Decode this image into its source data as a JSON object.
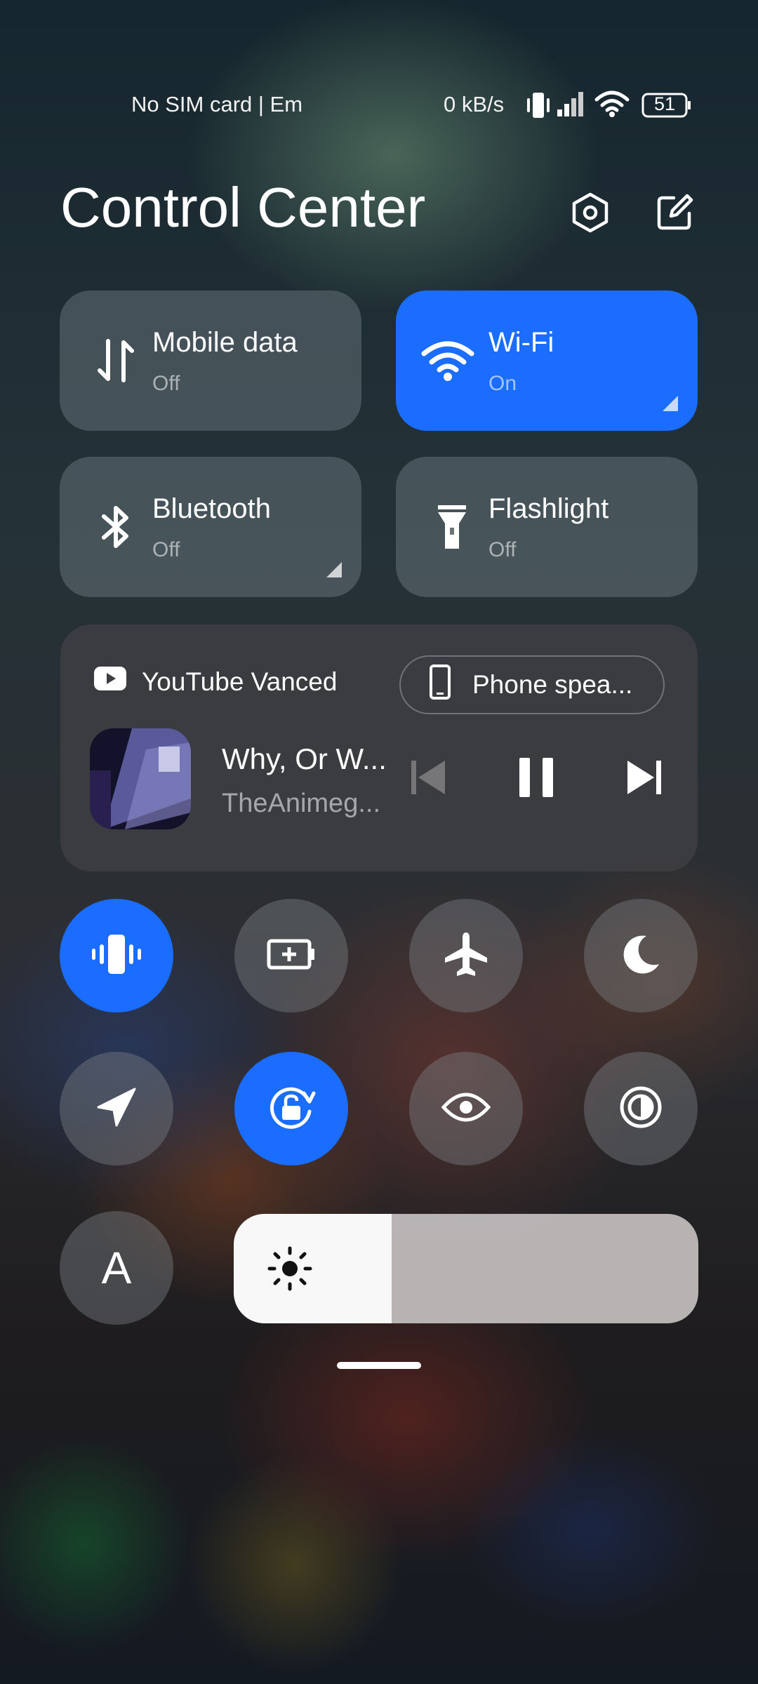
{
  "status_bar": {
    "carrier_text": "No SIM card | Em",
    "net_speed": "0 kB/s",
    "battery_level": "51",
    "icons": [
      "vibrate-icon",
      "signal-icon",
      "wifi-icon",
      "battery-icon"
    ]
  },
  "header": {
    "title": "Control Center",
    "settings_icon": "settings-hex-icon",
    "edit_icon": "edit-icon"
  },
  "tiles": [
    {
      "label": "Mobile data",
      "state": "Off",
      "icon": "mobile-data-icon",
      "active": false
    },
    {
      "label": "Wi-Fi",
      "state": "On",
      "icon": "wifi-icon",
      "active": true
    },
    {
      "label": "Bluetooth",
      "state": "Off",
      "icon": "bluetooth-icon",
      "active": false
    },
    {
      "label": "Flashlight",
      "state": "Off",
      "icon": "flashlight-icon",
      "active": false
    }
  ],
  "media": {
    "app_name": "YouTube Vanced",
    "output_device": "Phone spea...",
    "song_title": "Why, Or W...",
    "artist": "TheAnimeg...",
    "controls": [
      "previous-icon",
      "pause-icon",
      "next-icon"
    ]
  },
  "toggles": [
    {
      "name": "vibrate",
      "icon": "vibrate-icon",
      "active": true
    },
    {
      "name": "battery-saver",
      "icon": "battery-saver-icon",
      "active": false
    },
    {
      "name": "airplane-mode",
      "icon": "airplane-icon",
      "active": false
    },
    {
      "name": "dark-mode",
      "icon": "moon-icon",
      "active": false
    },
    {
      "name": "location",
      "icon": "location-icon",
      "active": false
    },
    {
      "name": "rotation-lock",
      "icon": "rotation-lock-icon",
      "active": true
    },
    {
      "name": "reading-mode",
      "icon": "eye-icon",
      "active": false
    },
    {
      "name": "contrast",
      "icon": "contrast-icon",
      "active": false
    }
  ],
  "auto_brightness": {
    "label": "A",
    "active": false
  },
  "brightness": {
    "level": 0.34,
    "icon": "sun-icon"
  },
  "colors": {
    "accent": "#1a6dff",
    "tile_bg": "#6a757c"
  }
}
